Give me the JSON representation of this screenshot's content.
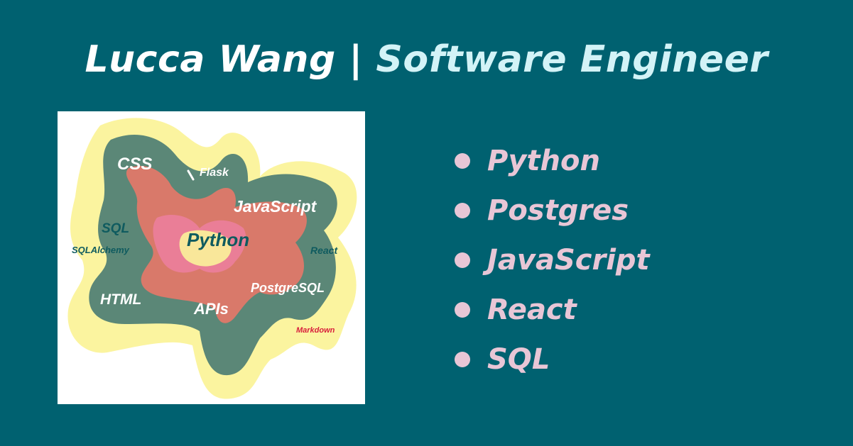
{
  "header": {
    "name": "Lucca Wang",
    "separator": "|",
    "role": "Software Engineer"
  },
  "word_cloud": {
    "words": [
      "CSS",
      "Flask",
      "JavaScript",
      "SQL",
      "Python",
      "SQLAlchemy",
      "React",
      "HTML",
      "PostgreSQL",
      "APIs",
      "Markdown"
    ]
  },
  "skills": {
    "items": [
      "Python",
      "Postgres",
      "JavaScript",
      "React",
      "SQL"
    ]
  },
  "colors": {
    "background": "#006170",
    "title_role": "#d3f3f7",
    "skill_text": "#e8c6d6",
    "blob_yellow": "#fbf39a",
    "blob_teal": "#3e7370",
    "blob_coral": "#f07767",
    "blob_pink": "#ee7fa3",
    "markdown_red": "#d81e3c"
  }
}
